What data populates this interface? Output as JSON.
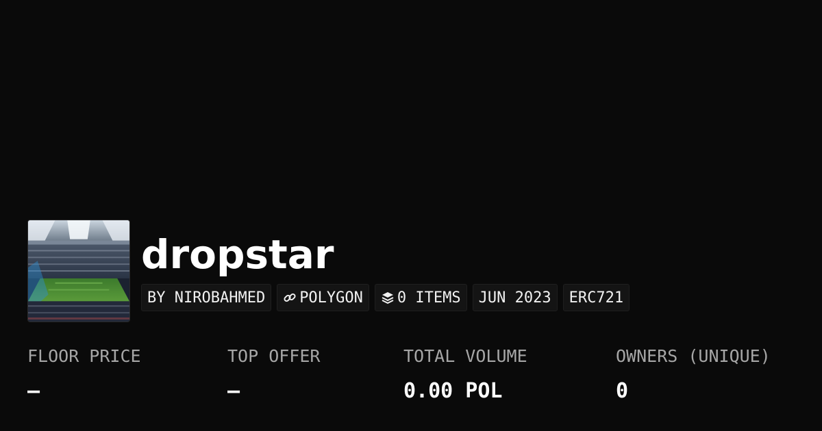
{
  "collection": {
    "name": "dropstar",
    "image": "stadium-image"
  },
  "tags": {
    "creator": "BY NIROBAHMED",
    "chain": "POLYGON",
    "chain_icon": "link-icon",
    "items": "0 ITEMS",
    "items_icon": "layers-icon",
    "date": "JUN 2023",
    "standard": "ERC721"
  },
  "stats": {
    "floor_price": {
      "label": "FLOOR PRICE",
      "value": "–"
    },
    "top_offer": {
      "label": "TOP OFFER",
      "value": "–"
    },
    "total_volume": {
      "label": "TOTAL VOLUME",
      "value": "0.00 POL"
    },
    "owners": {
      "label": "OWNERS (UNIQUE)",
      "value": "0"
    }
  },
  "colors": {
    "background": "#0a0a0a",
    "tag_background": "#141414",
    "label": "#a6a6a6",
    "text": "#ffffff"
  }
}
